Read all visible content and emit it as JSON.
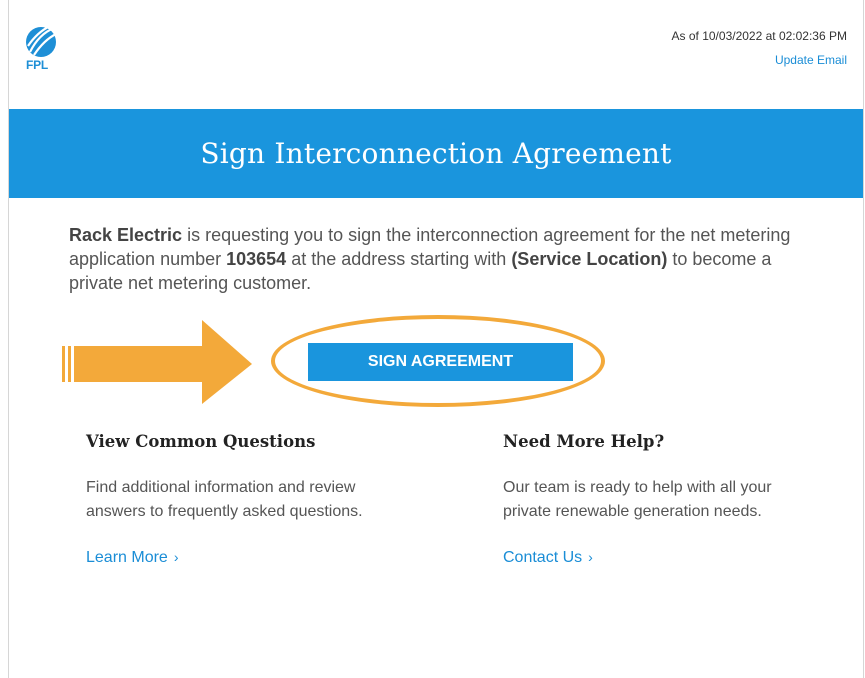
{
  "header": {
    "logo_text": "FPL",
    "as_of": "As of 10/03/2022 at 02:02:36 PM",
    "update_email": "Update Email"
  },
  "banner": {
    "title": "Sign Interconnection Agreement"
  },
  "intro": {
    "company": "Rack Electric",
    "text_1": " is requesting you to sign the interconnection agreement for the net metering application number ",
    "app_number": "103654",
    "text_2": " at the address starting with ",
    "location": "(Service Location)",
    "text_3": " to become a private net metering customer."
  },
  "sign_button": {
    "label": "SIGN AGREEMENT"
  },
  "left_column": {
    "heading": "View Common Questions",
    "body": "Find additional information and review answers to frequently asked questions.",
    "link": "Learn More",
    "link_icon": "chevron-right-icon"
  },
  "right_column": {
    "heading": "Need More Help?",
    "body": "Our team is ready to help with all your private renewable generation needs.",
    "link": "Contact Us",
    "link_icon": "chevron-right-icon"
  },
  "colors": {
    "brand_blue": "#1a95dd",
    "highlight_orange": "#f3a93a"
  }
}
